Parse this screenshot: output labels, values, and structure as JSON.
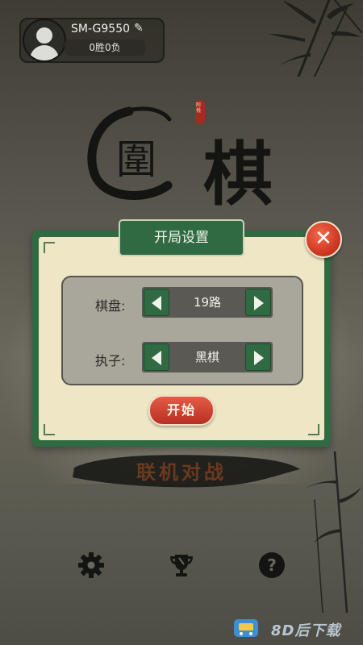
{
  "profile": {
    "username": "SM-G9550",
    "record": "0胜0负",
    "edit_icon": "pencil-icon",
    "avatar_icon": "user-avatar-icon"
  },
  "logo": {
    "char_1": "圍",
    "char_2": "棋",
    "seal_text": "阿悦"
  },
  "dialog": {
    "title": "开局设置",
    "close_icon": "close-icon",
    "board_label": "棋盘:",
    "board_value": "19路",
    "color_label": "执子:",
    "color_value": "黑棋",
    "start_label": "开始"
  },
  "main_menu": {
    "online_battle": "联机对战"
  },
  "bottom_bar": {
    "settings_icon": "gear-icon",
    "ranking_icon": "trophy-icon",
    "help_icon": "question-icon"
  },
  "watermark": {
    "text": "8D后下载"
  },
  "colors": {
    "dialog_green": "#2f6a43",
    "parchment": "#efe6c6",
    "close_red": "#d03a24",
    "start_red": "#c9392a"
  }
}
